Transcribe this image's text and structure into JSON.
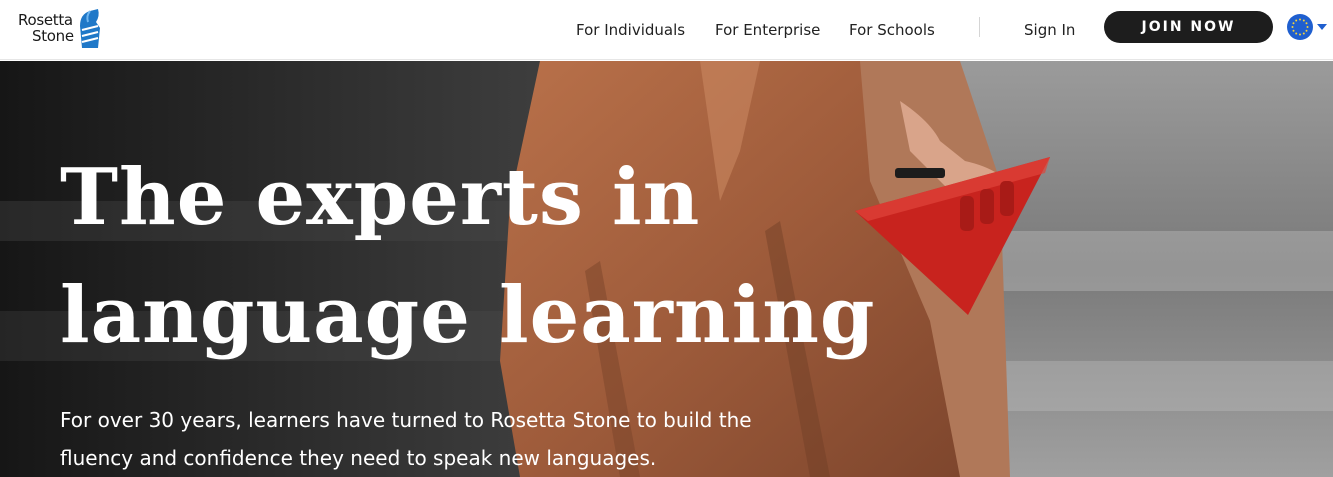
{
  "brand": {
    "name_line1": "Rosetta",
    "name_line2": "Stone",
    "logo_color": "#1f78c8"
  },
  "nav": {
    "items": [
      {
        "label": "For Individuals"
      },
      {
        "label": "For Enterprise"
      },
      {
        "label": "For Schools"
      }
    ],
    "sign_in": "Sign In",
    "join": "JOIN NOW",
    "locale_icon": "eu-flag-icon",
    "locale_chevron": "caret-down-icon"
  },
  "hero": {
    "title": "The experts in language learning",
    "subtitle": "For over 30 years, learners have turned to Rosetta Stone to build the fluency and confidence they need to speak new languages."
  },
  "colors": {
    "join_button_bg": "#1d1d1d",
    "accent_blue": "#1f5fcf",
    "bag_red": "#c8231e",
    "coat_brown": "#a4613f"
  }
}
